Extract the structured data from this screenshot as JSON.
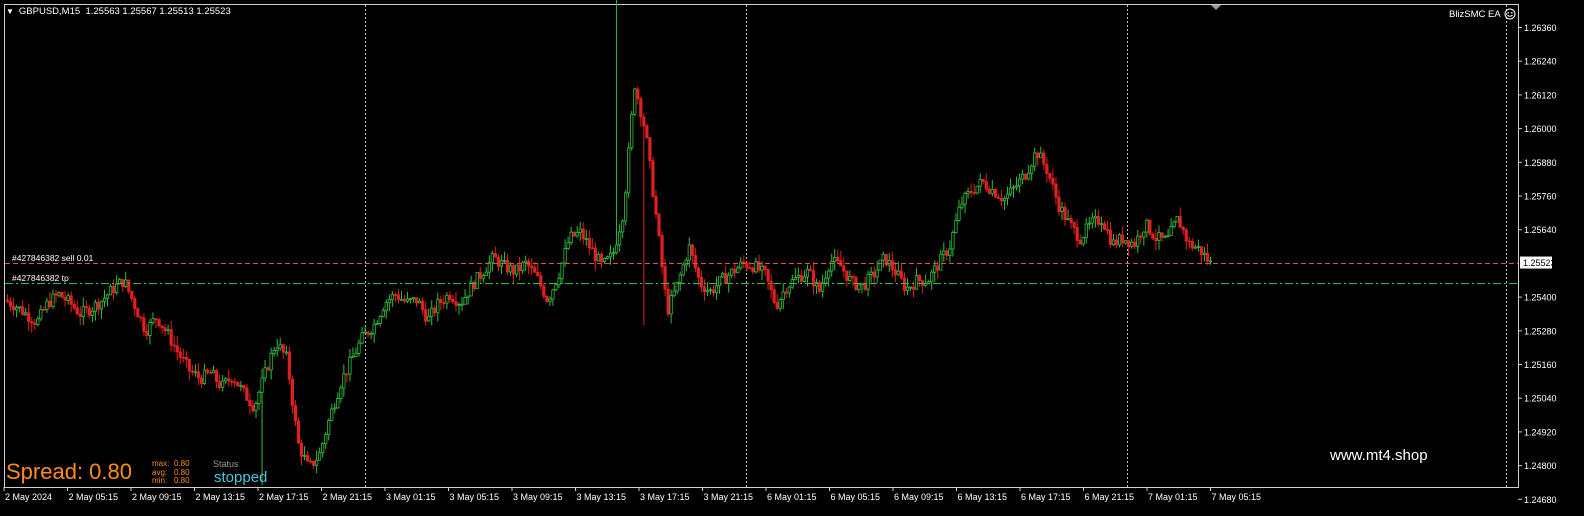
{
  "header": {
    "symbol_timeframe": "GBPUSD,M15",
    "ohlc": "1.25563 1.25567 1.25513 1.25523"
  },
  "ea_label": "BlizSMC EA",
  "icons": {
    "dropdown": "triangle-down-icon",
    "ea_status": "smiley-icon"
  },
  "spread": {
    "label": "Spread: 0.80",
    "max_label": "max:",
    "max_value": "0.80",
    "avg_label": "avg:",
    "avg_value": "0.80",
    "min_label": "min:",
    "min_value": "0.80"
  },
  "status": {
    "label": "Status",
    "value": "stopped"
  },
  "website": "www.mt4.shop",
  "orders": [
    {
      "label": "#427846382 sell 0.01",
      "price": 1.25523,
      "color": "#d9534f",
      "style": "dashed"
    },
    {
      "label": "#427846382 tp",
      "price": 1.2545,
      "color": "#2fbf3f",
      "style": "dashdot"
    }
  ],
  "current_price_label": "1.25523",
  "colors": {
    "bull": "#2fbf3f",
    "bear": "#e02020",
    "background": "#000000",
    "spread_text": "#ff8c1a",
    "status_text": "#4fc3e0"
  },
  "chart_data": {
    "type": "candlestick",
    "symbol": "GBPUSD",
    "timeframe": "M15",
    "ylim": [
      1.2466,
      1.2642
    ],
    "y_ticks": [
      "1.26360",
      "1.26240",
      "1.26120",
      "1.26000",
      "1.25880",
      "1.25760",
      "1.25640",
      "1.25523",
      "1.25400",
      "1.25280",
      "1.25160",
      "1.25040",
      "1.24920",
      "1.24800",
      "1.24680"
    ],
    "y_tick_values": [
      1.2636,
      1.2624,
      1.2612,
      1.26,
      1.2588,
      1.2576,
      1.2564,
      1.25523,
      1.254,
      1.2528,
      1.2516,
      1.2504,
      1.2492,
      1.248,
      1.2468
    ],
    "x_ticks": [
      "2 May 2024",
      "2 May 05:15",
      "2 May 09:15",
      "2 May 13:15",
      "2 May 17:15",
      "2 May 21:15",
      "3 May 01:15",
      "3 May 05:15",
      "3 May 09:15",
      "3 May 13:15",
      "3 May 17:15",
      "3 May 21:15",
      "6 May 01:15",
      "6 May 05:15",
      "6 May 09:15",
      "6 May 13:15",
      "6 May 17:15",
      "6 May 21:15",
      "7 May 01:15",
      "7 May 05:15"
    ],
    "period_separators": [
      "3 May 00:00",
      "6 May 00:00",
      "7 May 00:00"
    ],
    "close_path": [
      1.2539,
      1.2537,
      1.2534,
      1.2531,
      1.2538,
      1.2541,
      1.2538,
      1.2534,
      1.2536,
      1.2539,
      1.2543,
      1.2546,
      1.2537,
      1.2528,
      1.2533,
      1.2527,
      1.252,
      1.2514,
      1.2511,
      1.2513,
      1.2508,
      1.2512,
      1.2506,
      1.2501,
      1.2513,
      1.2524,
      1.2518,
      1.2488,
      1.2479,
      1.2484,
      1.2498,
      1.251,
      1.2518,
      1.2526,
      1.253,
      1.2538,
      1.2541,
      1.2538,
      1.2539,
      1.2532,
      1.2538,
      1.2541,
      1.2538,
      1.2544,
      1.2549,
      1.2554,
      1.2551,
      1.2549,
      1.2552,
      1.2547,
      1.2539,
      1.2548,
      1.2561,
      1.2563,
      1.2557,
      1.2551,
      1.2555,
      1.2571,
      1.2616,
      1.2599,
      1.2568,
      1.2535,
      1.2545,
      1.2558,
      1.2545,
      1.2542,
      1.2546,
      1.2549,
      1.2552,
      1.2551,
      1.2548,
      1.2537,
      1.2544,
      1.2547,
      1.2549,
      1.2542,
      1.2553,
      1.2551,
      1.2545,
      1.2544,
      1.2548,
      1.2554,
      1.2549,
      1.2543,
      1.2546,
      1.2546,
      1.2552,
      1.2558,
      1.2573,
      1.2578,
      1.2581,
      1.2578,
      1.2575,
      1.2579,
      1.2584,
      1.2592,
      1.2585,
      1.2573,
      1.2566,
      1.2561,
      1.2566,
      1.2568,
      1.2559,
      1.2561,
      1.2559,
      1.2566,
      1.2561,
      1.256,
      1.2568,
      1.2559,
      1.2557,
      1.2552
    ]
  }
}
